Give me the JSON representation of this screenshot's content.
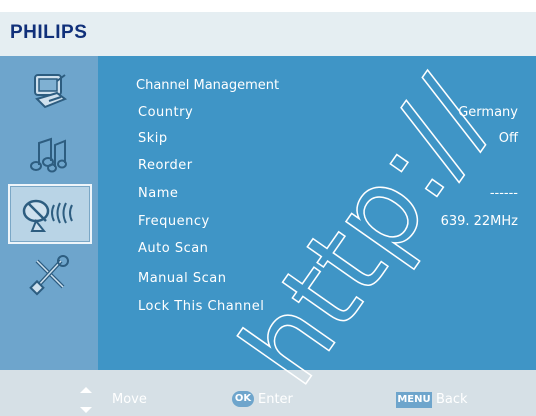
{
  "brand": "PHILIPS",
  "sidebar": {
    "items": [
      {
        "icon": "tv-settings-icon"
      },
      {
        "icon": "music-notes-icon"
      },
      {
        "icon": "satellite-dish-icon",
        "selected": true
      },
      {
        "icon": "tools-icon"
      }
    ]
  },
  "menu": {
    "title": "Channel Management",
    "rows": [
      {
        "label": "Country",
        "value": "Germany"
      },
      {
        "label": "Skip",
        "value": "Off"
      },
      {
        "label": "Reorder",
        "value": ""
      },
      {
        "label": "Name",
        "value": "------"
      },
      {
        "label": "Frequency",
        "value": "639. 22MHz"
      },
      {
        "label": "Auto Scan",
        "value": ""
      },
      {
        "label": "Manual Scan",
        "value": ""
      },
      {
        "label": "Lock This Channel",
        "value": ""
      }
    ]
  },
  "footer": {
    "move": "Move",
    "ok_key": "OK",
    "enter": "Enter",
    "menu_key": "MENU",
    "back": "Back"
  },
  "watermark": "http://",
  "colors": {
    "sidebar": "#6ea5cc",
    "main": "#3f95c6",
    "brand": "#10307a"
  }
}
